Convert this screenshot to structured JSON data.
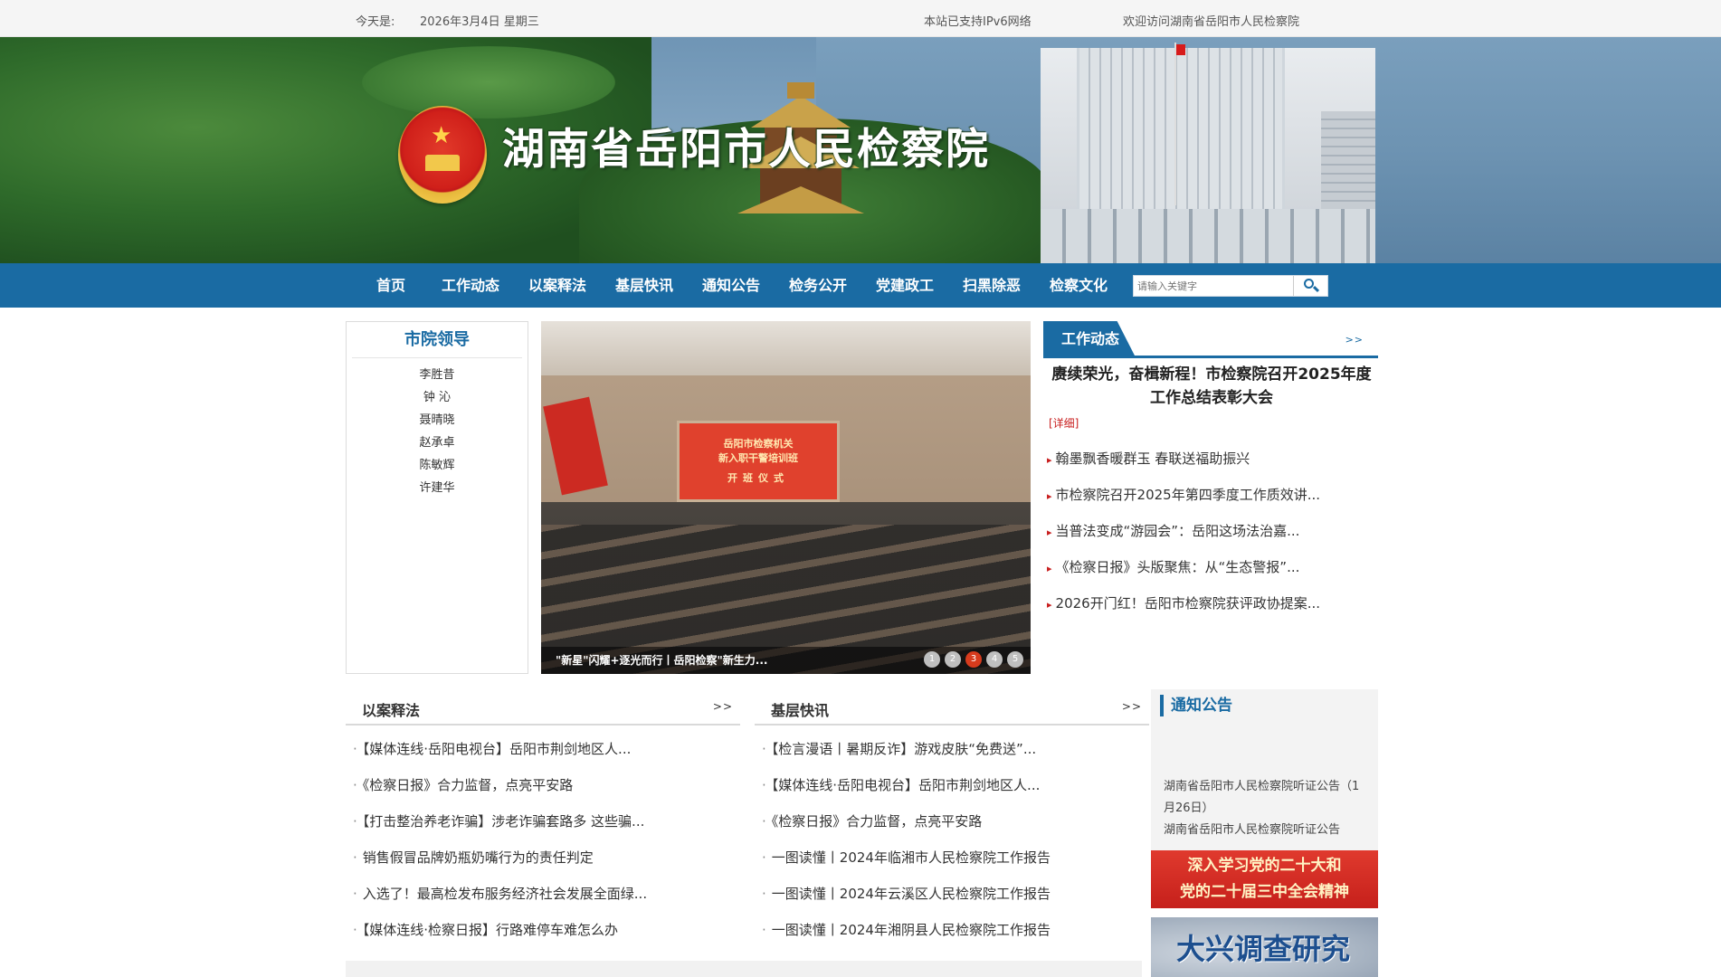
{
  "topbar": {
    "date_label": "今天是:",
    "date_value": "2026年3月4日 星期三",
    "ipv6": "本站已支持IPv6网络",
    "welcome": "欢迎访问湖南省岳阳市人民检察院"
  },
  "banner": {
    "title": "湖南省岳阳市人民检察院"
  },
  "nav": {
    "items": [
      "首页",
      "工作动态",
      "以案释法",
      "基层快讯",
      "通知公告",
      "检务公开",
      "党建政工",
      "扫黑除恶",
      "检察文化"
    ],
    "search_placeholder": "请输入关键字"
  },
  "leaders": {
    "title": "市院领导",
    "names": [
      "李胜昔",
      "钟 沁",
      "聂晴晓",
      "赵承卓",
      "陈敏辉",
      "许建华"
    ]
  },
  "slideshow": {
    "screen_line1": "岳阳市检察机关",
    "screen_line2": "新入职干警培训班",
    "screen_line3": "开班仪式",
    "caption": "\"新星\"闪耀+逐光而行丨岳阳检察\"新生力...",
    "pages": [
      "1",
      "2",
      "3",
      "4",
      "5"
    ],
    "active_page": 3
  },
  "work": {
    "tab": "工作动态",
    "more": ">>",
    "headline": "赓续荣光，奋楫新程！市检察院召开2025年度工作总结表彰大会",
    "detail": "[详细]",
    "items": [
      "翰墨飘香暖群玉 春联送福助振兴",
      "市检察院召开2025年第四季度工作质效讲...",
      "当普法变成“游园会”：岳阳这场法治嘉...",
      "《检察日报》头版聚焦：从“生态警报”...",
      "2026开门红！岳阳市检察院获评政协提案..."
    ]
  },
  "cases": {
    "title": "以案释法",
    "more": ">>",
    "items": [
      "【媒体连线·岳阳电视台】岳阳市荆剑地区人...",
      "《检察日报》合力监督，点亮平安路",
      "【打击整治养老诈骗】涉老诈骗套路多 这些骗...",
      "销售假冒品牌奶瓶奶嘴行为的责任判定",
      "入选了！最高检发布服务经济社会发展全面绿...",
      "【媒体连线·检察日报】行路难停车难怎么办"
    ]
  },
  "grassroots": {
    "title": "基层快讯",
    "more": ">>",
    "items": [
      "【检言漫语丨暑期反诈】游戏皮肤“免费送”...",
      "【媒体连线·岳阳电视台】岳阳市荆剑地区人...",
      "《检察日报》合力监督，点亮平安路",
      "一图读懂丨2024年临湘市人民检察院工作报告",
      "一图读懂丨2024年云溪区人民检察院工作报告",
      "一图读懂丨2024年湘阴县人民检察院工作报告"
    ]
  },
  "notice": {
    "title": "通知公告",
    "item1": "湖南省岳阳市人民检察院听证公告（1月26日）",
    "item2": "湖南省岳阳市人民检察院听证公告"
  },
  "promo": {
    "line1": "深入学习党的二十大和",
    "line2": "党的二十届三中全会精神",
    "survey": "大兴调查研究"
  },
  "colors": {
    "brand": "#1a6ba3",
    "accent_red": "#c81e1e"
  }
}
